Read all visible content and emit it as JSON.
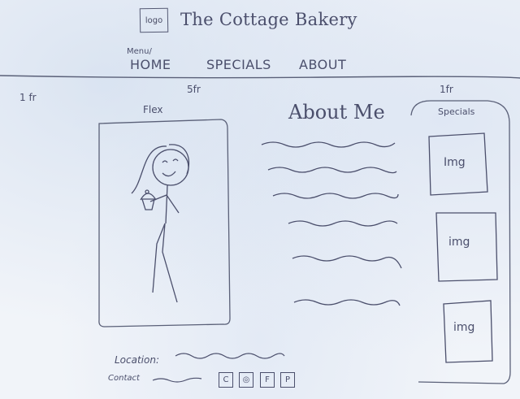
{
  "header": {
    "logo_label": "logo",
    "title": "The Cottage Bakery"
  },
  "nav": {
    "menu_label": "Menu/",
    "items": [
      "HOME",
      "SPECIALS",
      "ABOUT"
    ]
  },
  "grid": {
    "left_fraction": "1 fr",
    "main_fraction": "5fr",
    "right_fraction": "1fr"
  },
  "main": {
    "flex_label": "Flex",
    "about_title": "About Me"
  },
  "specials": {
    "label": "Specials",
    "images": [
      "Img",
      "img",
      "img"
    ]
  },
  "footer": {
    "location_label": "Location:",
    "contact_label": "Contact",
    "social_icons": [
      "C",
      "◎",
      "F",
      "P"
    ]
  },
  "colors": {
    "ink": "#4b4f6c",
    "paper": "#f1f4f9"
  }
}
